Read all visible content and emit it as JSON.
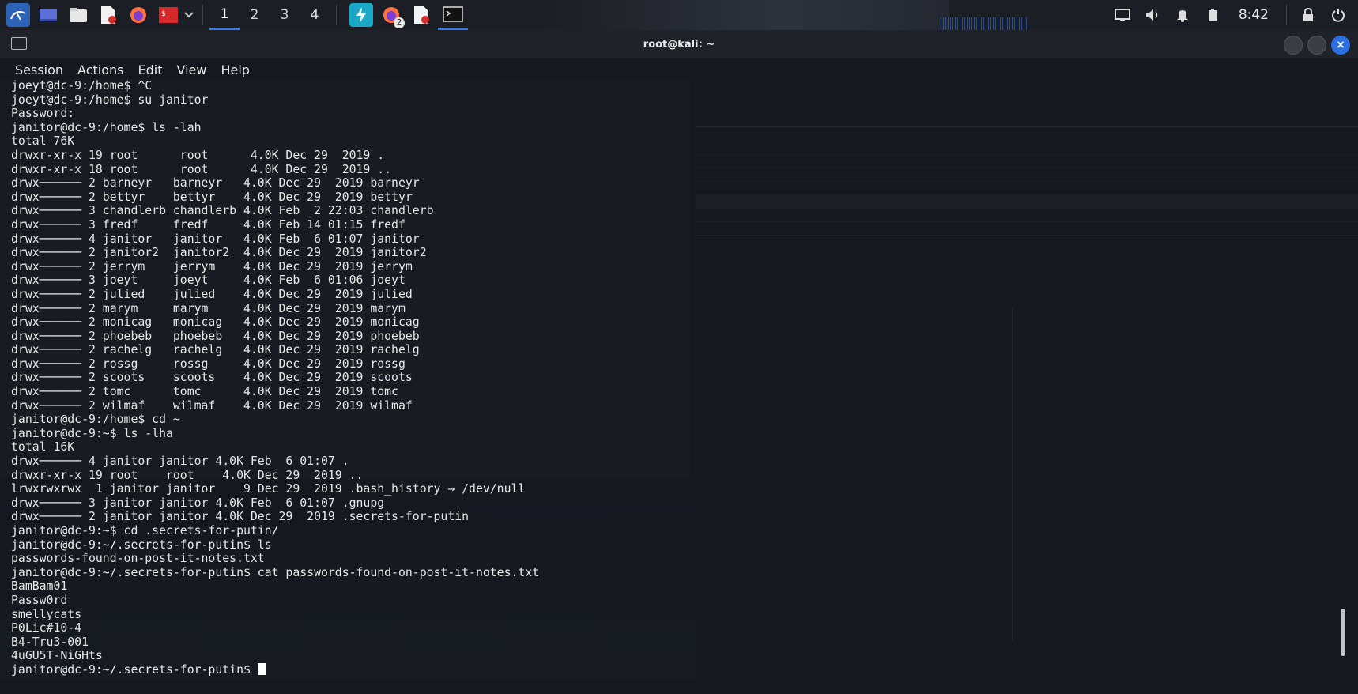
{
  "taskbar": {
    "workspaces": [
      "1",
      "2",
      "3",
      "4"
    ],
    "active_workspace": 0,
    "clock": "8:42",
    "firefox_badge": "2",
    "icons": [
      "kali-menu-icon",
      "desktop-icon",
      "file-manager-icon",
      "text-editor-icon",
      "firefox-icon",
      "terminal-red-icon",
      "chevron-down-icon",
      "burp-suite-icon",
      "firefox-private-icon",
      "text-editor-2-icon",
      "terminal-icon"
    ],
    "tray_icons": [
      "display-icon",
      "volume-icon",
      "notification-bell-icon",
      "battery-icon",
      "lock-icon",
      "power-icon"
    ]
  },
  "window": {
    "title": "root@kali: ~",
    "menu": [
      "Session",
      "Actions",
      "Edit",
      "View",
      "Help"
    ]
  },
  "terminal": {
    "lines": [
      "joeyt@dc-9:/home$ ^C",
      "joeyt@dc-9:/home$ su janitor",
      "Password: ",
      "janitor@dc-9:/home$ ls -lah",
      "total 76K",
      "drwxr-xr-x 19 root      root      4.0K Dec 29  2019 .",
      "drwxr-xr-x 18 root      root      4.0K Dec 29  2019 ..",
      "drwx────── 2 barneyr   barneyr   4.0K Dec 29  2019 barneyr",
      "drwx────── 2 bettyr    bettyr    4.0K Dec 29  2019 bettyr",
      "drwx────── 3 chandlerb chandlerb 4.0K Feb  2 22:03 chandlerb",
      "drwx────── 3 fredf     fredf     4.0K Feb 14 01:15 fredf",
      "drwx────── 4 janitor   janitor   4.0K Feb  6 01:07 janitor",
      "drwx────── 2 janitor2  janitor2  4.0K Dec 29  2019 janitor2",
      "drwx────── 2 jerrym    jerrym    4.0K Dec 29  2019 jerrym",
      "drwx────── 3 joeyt     joeyt     4.0K Feb  6 01:06 joeyt",
      "drwx────── 2 julied    julied    4.0K Dec 29  2019 julied",
      "drwx────── 2 marym     marym     4.0K Dec 29  2019 marym",
      "drwx────── 2 monicag   monicag   4.0K Dec 29  2019 monicag",
      "drwx────── 2 phoebeb   phoebeb   4.0K Dec 29  2019 phoebeb",
      "drwx────── 2 rachelg   rachelg   4.0K Dec 29  2019 rachelg",
      "drwx────── 2 rossg     rossg     4.0K Dec 29  2019 rossg",
      "drwx────── 2 scoots    scoots    4.0K Dec 29  2019 scoots",
      "drwx────── 2 tomc      tomc      4.0K Dec 29  2019 tomc",
      "drwx────── 2 wilmaf    wilmaf    4.0K Dec 29  2019 wilmaf",
      "janitor@dc-9:/home$ cd ~",
      "janitor@dc-9:~$ ls -lha",
      "total 16K",
      "drwx────── 4 janitor janitor 4.0K Feb  6 01:07 .",
      "drwxr-xr-x 19 root    root    4.0K Dec 29  2019 ..",
      "lrwxrwxrwx  1 janitor janitor    9 Dec 29  2019 .bash_history → /dev/null",
      "drwx────── 3 janitor janitor 4.0K Feb  6 01:07 .gnupg",
      "drwx────── 2 janitor janitor 4.0K Dec 29  2019 .secrets-for-putin",
      "janitor@dc-9:~$ cd .secrets-for-putin/",
      "janitor@dc-9:~/.secrets-for-putin$ ls",
      "passwords-found-on-post-it-notes.txt",
      "janitor@dc-9:~/.secrets-for-putin$ cat passwords-found-on-post-it-notes.txt",
      "BamBam01",
      "Passw0rd",
      "smellycats",
      "P0Lic#10-4",
      "B4-Tru3-001",
      "4uGU5T-NiGHts"
    ],
    "prompt": "janitor@dc-9:~/.secrets-for-putin$ "
  },
  "colors": {
    "accent": "#367bf0",
    "terminal_bg": "#15181f",
    "text": "#e8e8e8"
  }
}
